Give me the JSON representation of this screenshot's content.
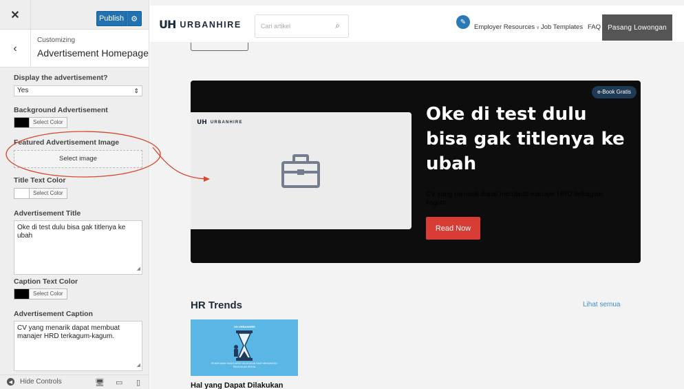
{
  "customizer": {
    "close_icon": "close-icon",
    "publish_label": "Publish",
    "publish_gear_icon": "gear-icon",
    "breadcrumb": "Customizing",
    "section_title": "Advertisement Homepage",
    "display_ad": {
      "label": "Display the advertisement?",
      "value": "Yes"
    },
    "background_ad": {
      "label": "Background Advertisement",
      "button": "Select Color",
      "color": "#000000"
    },
    "featured_image": {
      "label": "Featured Advertisement Image",
      "button": "Select image"
    },
    "title_text_color": {
      "label": "Title Text Color",
      "button": "Select Color",
      "color": "#ffffff"
    },
    "ad_title": {
      "label": "Advertisement Title",
      "value": "Oke di test dulu bisa gak titlenya ke ubah"
    },
    "caption_text_color": {
      "label": "Caption Text Color",
      "button": "Select Color",
      "color": "#000000"
    },
    "ad_caption": {
      "label": "Advertisement Caption",
      "value": "CV yang menarik dapat membuat manajer HRD terkagum-kagum."
    },
    "footer": {
      "hide_controls": "Hide Controls"
    }
  },
  "site": {
    "logo_mark": "UH",
    "logo_text": "URBANHIRE",
    "search_placeholder": "Cari artikel",
    "nav": {
      "employer_resources": "Employer Resources",
      "job_templates": "Job Templates",
      "faq": "FAQ"
    },
    "cta": "Pasang Lowongan",
    "banner": {
      "badge": "e-Book Gratis",
      "card_logo_mark": "UH",
      "card_logo_text": "URBANHIRE",
      "title": "Oke di test dulu bisa gak titlenya ke ubah",
      "caption": "CV yang menarik dapat membuat manajer HRD terkagum-kagum.",
      "button": "Read Now"
    },
    "hr_trends": {
      "heading": "HR Trends",
      "see_all": "Lihat semua",
      "thumb_logo": "UH URBANHIRE",
      "thumb_text": "PEKERJAAN YANG DAPAT DILAKUKAN SAAT MENUNGGU PANGGILAN KERJA",
      "article_title": "Hal yang Dapat Dilakukan"
    }
  },
  "colors": {
    "publish": "#2271b1",
    "banner_bg": "#0d0d0d",
    "read_now": "#d73c35",
    "annotation": "#d9452f",
    "link": "#3d8fd1"
  }
}
